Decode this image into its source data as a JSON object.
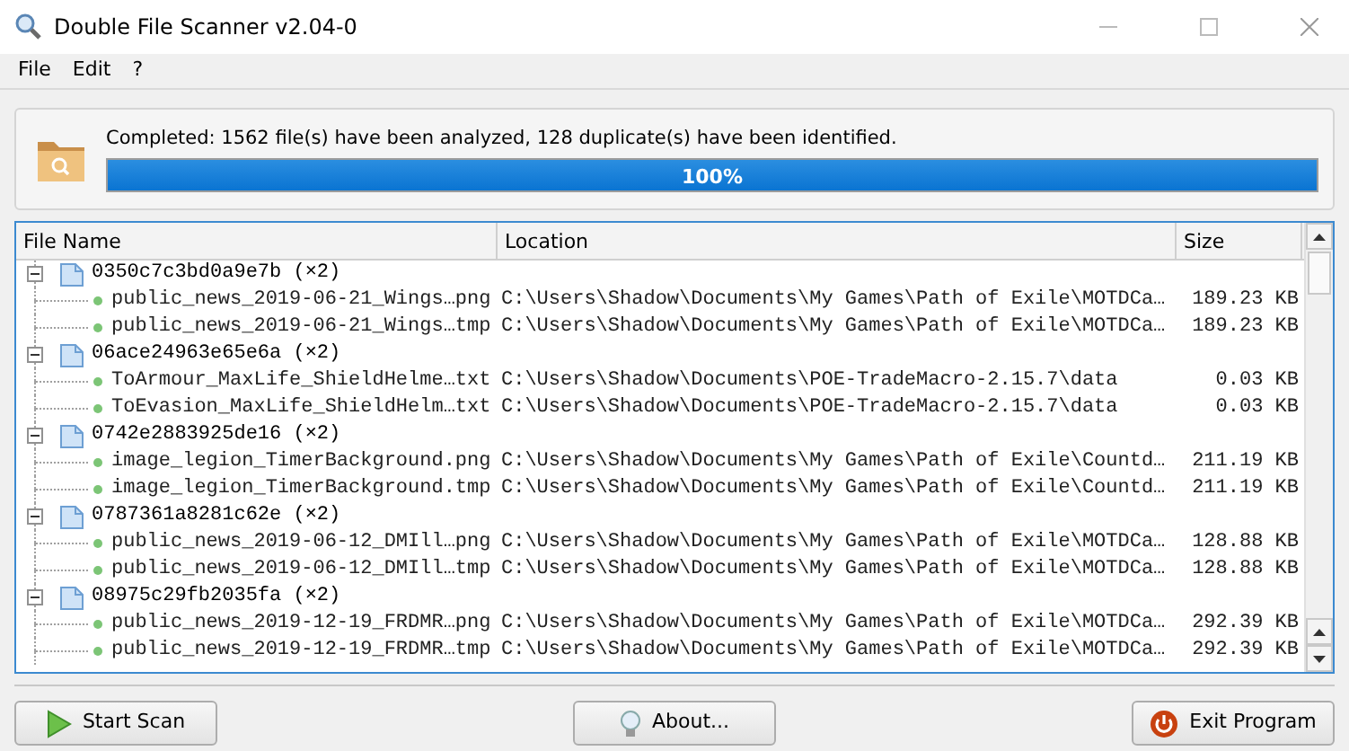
{
  "window": {
    "title": "Double File Scanner v2.04-0"
  },
  "menu": [
    "File",
    "Edit",
    "?"
  ],
  "status": {
    "message": "Completed: 1562 file(s) have been analyzed, 128 duplicate(s) have been identified.",
    "progress": {
      "level": 1,
      "reading": "100%"
    }
  },
  "table": {
    "columns": [
      "File Name",
      "Location",
      "Size"
    ],
    "groups": [
      {
        "hash": "0350c7c3bd0a9e7b",
        "count": "(×2)",
        "expanded": true,
        "files": [
          {
            "name": "public_news_2019-06-21_Wings…png",
            "location": "C:\\Users\\Shadow\\Documents\\My Games\\Path of Exile\\MOTDCa…",
            "size": "189.23 KB"
          },
          {
            "name": "public_news_2019-06-21_Wings…tmp",
            "location": "C:\\Users\\Shadow\\Documents\\My Games\\Path of Exile\\MOTDCa…",
            "size": "189.23 KB"
          }
        ]
      },
      {
        "hash": "06ace24963e65e6a",
        "count": "(×2)",
        "expanded": true,
        "files": [
          {
            "name": "ToArmour_MaxLife_ShieldHelme…txt",
            "location": "C:\\Users\\Shadow\\Documents\\POE-TradeMacro-2.15.7\\data",
            "size": "0.03 KB"
          },
          {
            "name": "ToEvasion_MaxLife_ShieldHelm…txt",
            "location": "C:\\Users\\Shadow\\Documents\\POE-TradeMacro-2.15.7\\data",
            "size": "0.03 KB"
          }
        ]
      },
      {
        "hash": "0742e2883925de16",
        "count": "(×2)",
        "expanded": true,
        "files": [
          {
            "name": "image_legion_TimerBackground.png",
            "location": "C:\\Users\\Shadow\\Documents\\My Games\\Path of Exile\\Countd…",
            "size": "211.19 KB"
          },
          {
            "name": "image_legion_TimerBackground.tmp",
            "location": "C:\\Users\\Shadow\\Documents\\My Games\\Path of Exile\\Countd…",
            "size": "211.19 KB"
          }
        ]
      },
      {
        "hash": "0787361a8281c62e",
        "count": "(×2)",
        "expanded": true,
        "files": [
          {
            "name": "public_news_2019-06-12_DMIll…png",
            "location": "C:\\Users\\Shadow\\Documents\\My Games\\Path of Exile\\MOTDCa…",
            "size": "128.88 KB"
          },
          {
            "name": "public_news_2019-06-12_DMIll…tmp",
            "location": "C:\\Users\\Shadow\\Documents\\My Games\\Path of Exile\\MOTDCa…",
            "size": "128.88 KB"
          }
        ]
      },
      {
        "hash": "08975c29fb2035fa",
        "count": "(×2)",
        "expanded": true,
        "files": [
          {
            "name": "public_news_2019-12-19_FRDMR…png",
            "location": "C:\\Users\\Shadow\\Documents\\My Games\\Path of Exile\\MOTDCa…",
            "size": "292.39 KB"
          },
          {
            "name": "public_news_2019-12-19_FRDMR…tmp",
            "location": "C:\\Users\\Shadow\\Documents\\My Games\\Path of Exile\\MOTDCa…",
            "size": "292.39 KB"
          }
        ]
      }
    ]
  },
  "buttons": [
    {
      "kind": "start",
      "label": "Start Scan"
    },
    {
      "kind": "about",
      "label": "About..."
    },
    {
      "kind": "exit",
      "label": "Exit Program"
    }
  ]
}
